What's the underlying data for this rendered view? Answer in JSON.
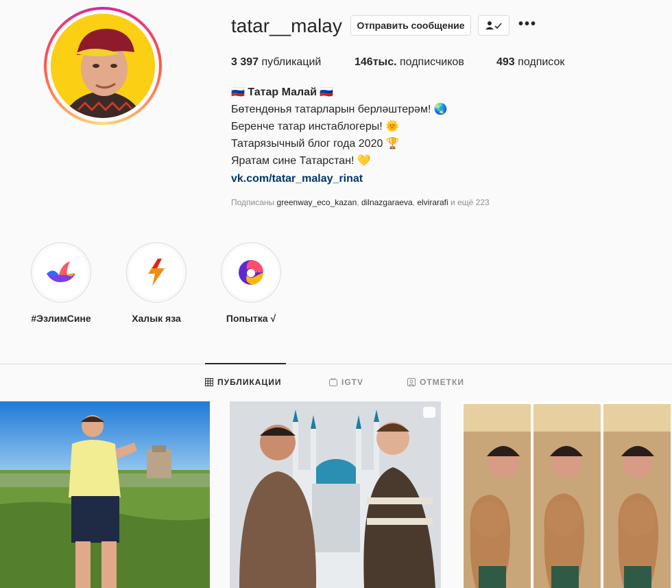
{
  "profile": {
    "username": "tatar__malay",
    "send_message_label": "Отправить сообщение",
    "more_label": "•••"
  },
  "stats": {
    "posts_value": "3 397",
    "posts_label": "публикаций",
    "followers_value": "146тыс.",
    "followers_label": "подписчиков",
    "following_value": "493",
    "following_label": "подписок"
  },
  "bio": {
    "name": "🇷🇺 Татар Малай 🇷🇺",
    "line1": "Бөтендөнья татарларын берләштерәм! 🌏",
    "line2": "Беренче татар инстаблогеры! 🌞",
    "line3": "Татарязычный блог года 2020 🏆",
    "line4": "Яратам сине Татарстан! 💛",
    "link": "vk.com/tatar_malay_rinat"
  },
  "followed_by": {
    "prefix": "Подписаны",
    "user1": "greenway_eco_kazan",
    "user2": "dilnazgaraeva",
    "user3": "elvirarafi",
    "suffix": "и ещё 223"
  },
  "highlights": [
    {
      "label": "#ЭзлимСине",
      "icon": "bird-icon"
    },
    {
      "label": "Халык яза",
      "icon": "lightning-icon"
    },
    {
      "label": "Попытка √",
      "icon": "edge-logo-icon"
    }
  ],
  "tabs": {
    "posts": "ПУБЛИКАЦИИ",
    "igtv": "IGTV",
    "tagged": "ОТМЕТКИ"
  },
  "colors": {
    "link": "#00376b",
    "muted": "#8e8e8e",
    "border": "#dbdbdb",
    "avatar_bg": "#fbcf13"
  }
}
